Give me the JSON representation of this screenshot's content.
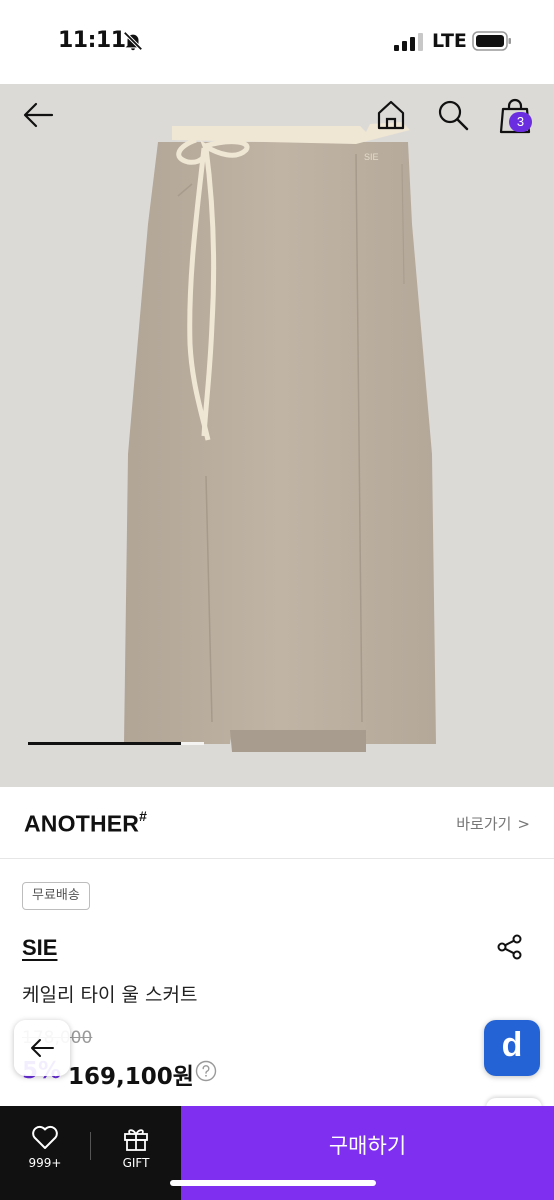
{
  "status_bar": {
    "time": "11:11",
    "network": "LTE"
  },
  "nav": {
    "cart_count": "3"
  },
  "gallery": {
    "progress": 0.87,
    "accent": "#6b2de0"
  },
  "hero_image": {
    "logo_text": "SIE"
  },
  "brand_row": {
    "logo": "ANOTHER",
    "logo_mark": "#",
    "shortcut": "바로가기",
    "shortcut_chevron": ">"
  },
  "product": {
    "shipping_tag": "무료배송",
    "brand": "SIE",
    "name": "케일리 타이 울 스커트",
    "original_price": "178,000",
    "discount_rate": "5%",
    "sale_price": "169,100원"
  },
  "floating": {
    "d_label": "d"
  },
  "bottom_bar": {
    "wish_count": "999+",
    "gift_label": "GIFT",
    "buy_label": "구매하기",
    "buy_color": "#7f2ff0"
  }
}
